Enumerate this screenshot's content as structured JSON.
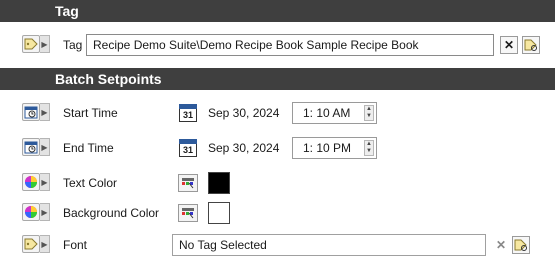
{
  "sections": {
    "tag_header": "Tag",
    "batch_header": "Batch Setpoints"
  },
  "tag_row": {
    "label": "Tag",
    "value": "Recipe Demo Suite\\Demo Recipe Book   Sample Recipe Book",
    "clear_icon": "close-icon",
    "browse_icon": "tag-browse-icon"
  },
  "start_time": {
    "label": "Start Time",
    "date": "Sep 30, 2024",
    "time": "1: 10 AM"
  },
  "end_time": {
    "label": "End Time",
    "date": "Sep 30, 2024",
    "time": "1: 10 PM"
  },
  "text_color": {
    "label": "Text Color",
    "color": "#000000"
  },
  "background_color": {
    "label": "Background Color",
    "color": "#ffffff"
  },
  "font_row": {
    "label": "Font",
    "value": "No Tag Selected"
  },
  "calendar_day": "31",
  "colors": {
    "header_bg": "#3f3f3f",
    "calendar_accent": "#2d5a9b"
  }
}
